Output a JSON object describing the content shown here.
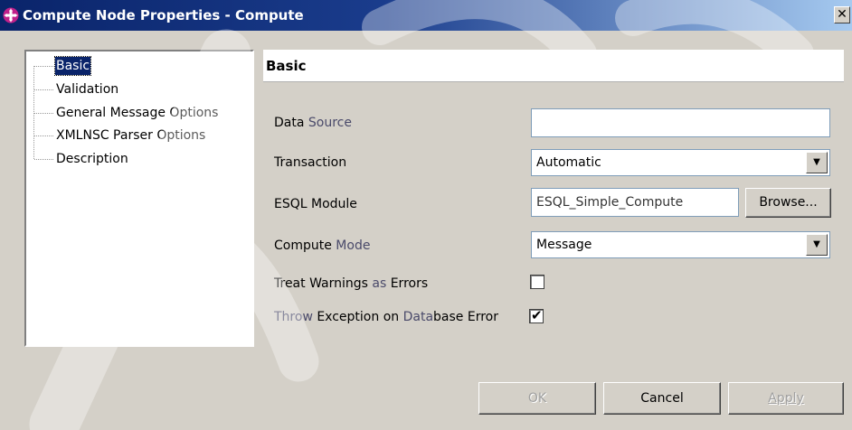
{
  "window": {
    "title": "Compute Node Properties - Compute",
    "close_glyph": "✕",
    "title_icon": "compute-node-icon"
  },
  "tree": {
    "items": [
      {
        "label": "Basic",
        "selected": true
      },
      {
        "label": "Validation"
      },
      {
        "label": "General Message Options"
      },
      {
        "label": "XMLNSC Parser Options"
      },
      {
        "label": "Description"
      }
    ]
  },
  "section": {
    "title": "Basic"
  },
  "fields": {
    "data_source": {
      "label_a": "Data ",
      "label_b": "Source",
      "value": ""
    },
    "transaction": {
      "label": "Transaction",
      "value": "Automatic"
    },
    "esql_module": {
      "label": "ESQL Module",
      "value": "ESQL_Simple_Compute",
      "browse_label": "Browse..."
    },
    "compute_mode": {
      "label_a": "Compute ",
      "label_b": "Mode",
      "value": "Message"
    },
    "treat_warnings": {
      "label_a": "Treat Warnings ",
      "label_b": "as",
      "label_c": " Errors",
      "checked": false
    },
    "throw_exception": {
      "label_a": "Throw",
      "label_b": " Exception on ",
      "label_c": "Data",
      "label_d": "base Error",
      "checked": true
    }
  },
  "buttons": {
    "ok": "OK",
    "cancel": "Cancel",
    "apply": "Apply"
  },
  "glyphs": {
    "dropdown_arrow": "▼",
    "check": "✔"
  },
  "colors": {
    "title_bar": "#0a246a",
    "selection": "#0a246a",
    "dialog_bg": "#d4d0c8"
  }
}
